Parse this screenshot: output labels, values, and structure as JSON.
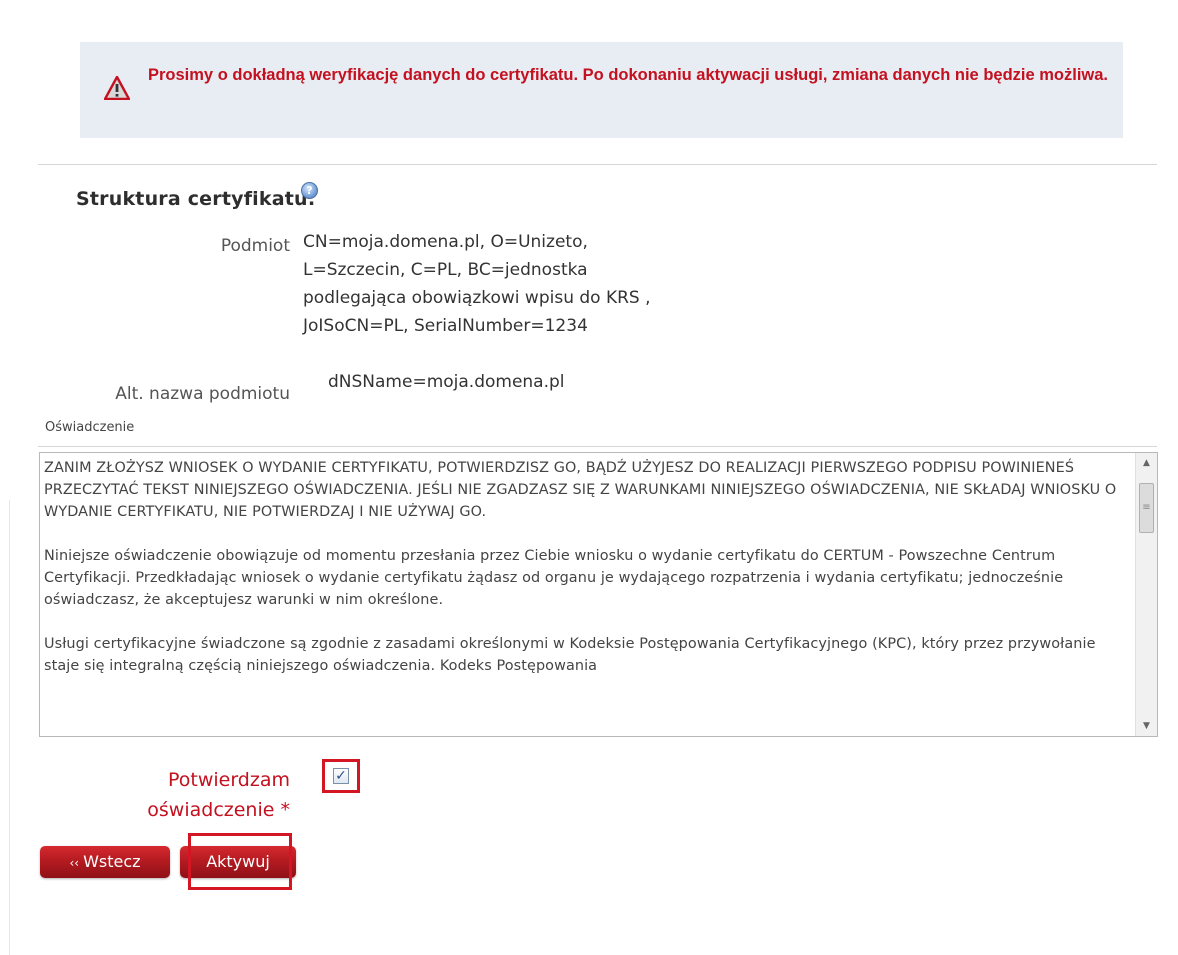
{
  "alert": {
    "icon": "warning-triangle-icon",
    "text": "Prosimy o dokładną weryfikację danych do certyfikatu. Po dokonaniu aktywacji usługi, zmiana danych nie będzie możliwa."
  },
  "structure": {
    "title": "Struktura certyfikatu:",
    "help_icon": "help-icon",
    "help_glyph": "?",
    "subject_label": "Podmiot",
    "subject_lines": [
      "CN=moja.domena.pl, O=Unizeto,",
      "L=Szczecin, C=PL, BC=jednostka",
      "podlegająca obowiązkowi wpisu do KRS ,",
      "JoISoCN=PL, SerialNumber=1234"
    ],
    "alt_label": "Alt. nazwa podmiotu",
    "alt_value": "dNSName=moja.domena.pl"
  },
  "declaration": {
    "label": "Oświadczenie",
    "paragraphs": [
      "ZANIM ZŁOŻYSZ WNIOSEK O WYDANIE CERTYFIKATU, POTWIERDZISZ GO, BĄDŹ UŻYJESZ DO REALIZACJI PIERWSZEGO PODPISU POWINIENEŚ PRZECZYTAĆ TEKST NINIEJSZEGO OŚWIADCZENIA. JEŚLI NIE ZGADZASZ SIĘ Z WARUNKAMI NINIEJSZEGO OŚWIADCZENIA, NIE SKŁADAJ WNIOSKU O WYDANIE CERTYFIKATU, NIE POTWIERDZAJ I NIE UŻYWAJ GO.",
      "Niniejsze oświadczenie obowiązuje od momentu przesłania przez Ciebie wniosku o wydanie certyfikatu do CERTUM - Powszechne Centrum Certyfikacji. Przedkładając wniosek o wydanie certyfikatu żądasz od organu je wydającego rozpatrzenia i wydania certyfikatu; jednocześnie oświadczasz, że akceptujesz warunki w nim określone.",
      "Usługi certyfikacyjne świadczone są zgodnie z zasadami określonymi w Kodeksie Postępowania Certyfikacyjnego (KPC), który przez przywołanie staje się integralną częścią niniejszego oświadczenia. Kodeks Postępowania"
    ],
    "scroll_up": "▲",
    "scroll_down": "▼",
    "scroll_grip": "≡"
  },
  "confirm": {
    "line1": "Potwierdzam",
    "line2": "oświadczenie *",
    "check_glyph": "✓"
  },
  "buttons": {
    "back_chevron": "‹‹",
    "back_label": "Wstecz",
    "activate_label": "Aktywuj"
  },
  "colors": {
    "accent": "#c4101f",
    "alert_bg": "#e8edf3",
    "button": "#b11a20"
  }
}
